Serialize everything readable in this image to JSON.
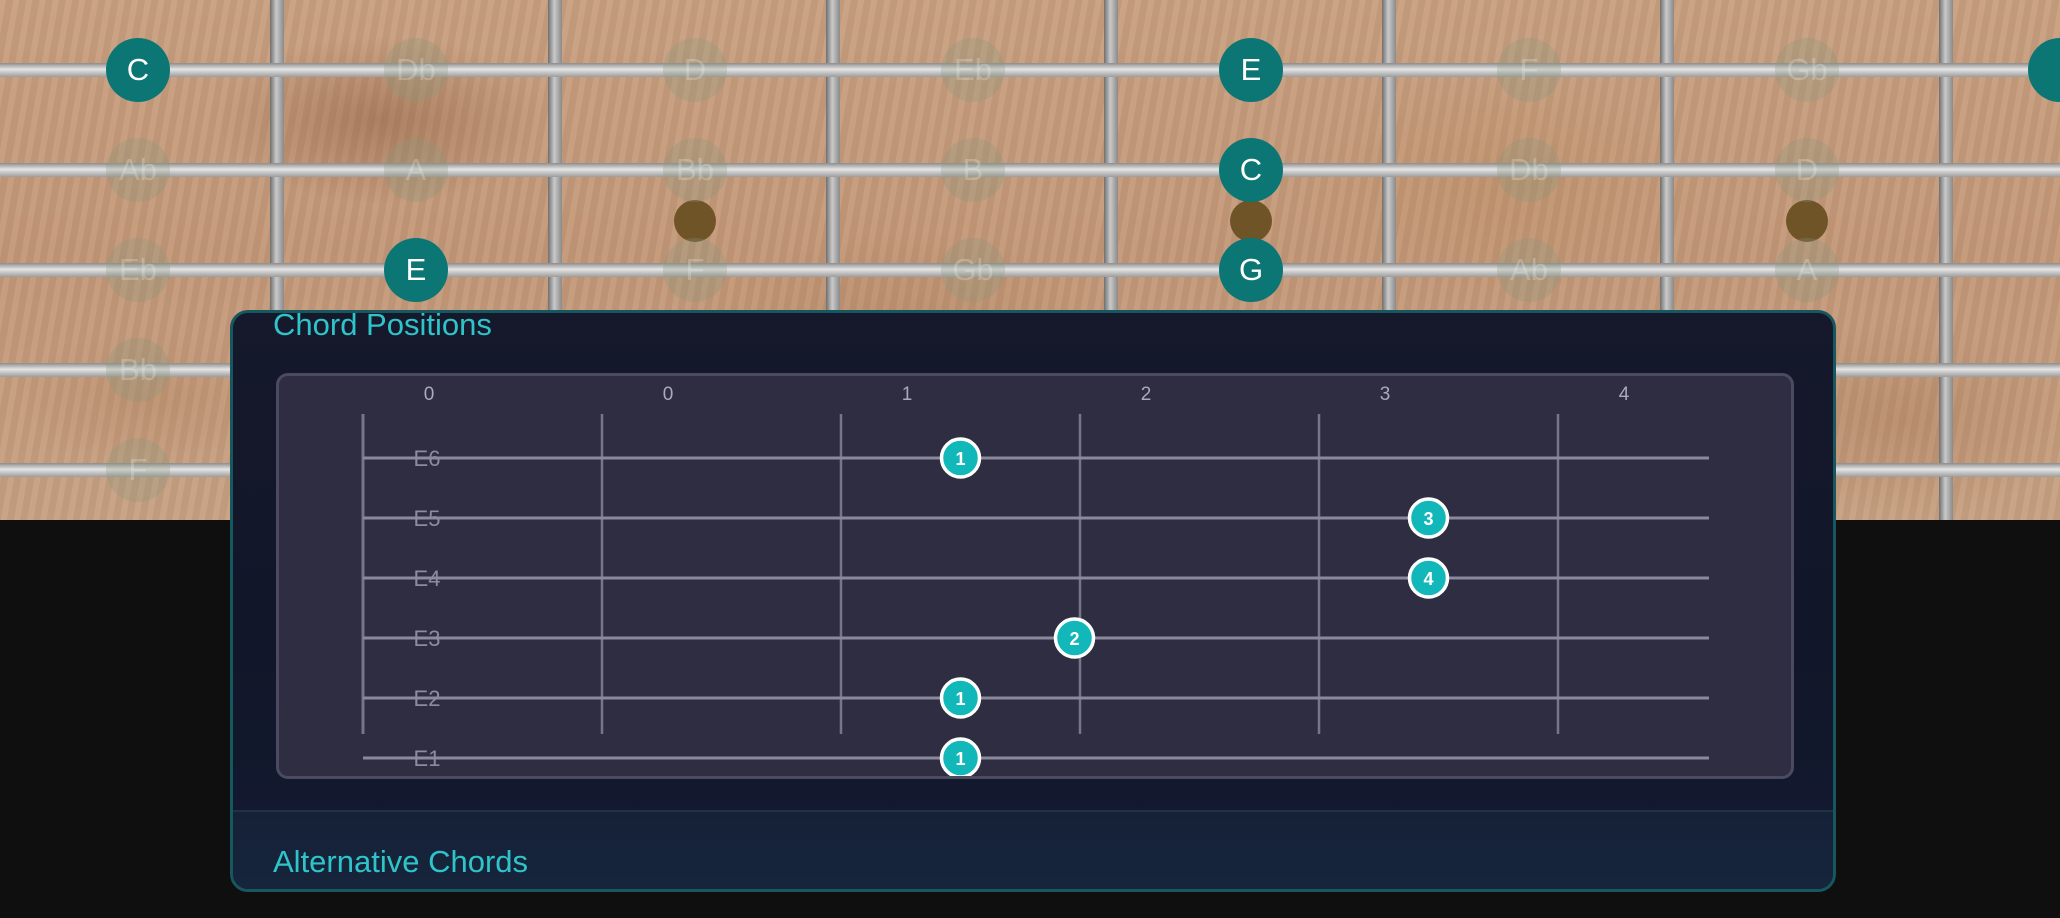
{
  "fretboard": {
    "rows": [
      {
        "notes": [
          {
            "label": "C",
            "active": true
          },
          {
            "label": "Db",
            "active": false
          },
          {
            "label": "D",
            "active": false
          },
          {
            "label": "Eb",
            "active": false
          },
          {
            "label": "E",
            "active": true
          },
          {
            "label": "F",
            "active": false
          },
          {
            "label": "Gb",
            "active": false
          },
          {
            "label": "",
            "active": true
          }
        ]
      },
      {
        "notes": [
          {
            "label": "Ab",
            "active": false
          },
          {
            "label": "A",
            "active": false
          },
          {
            "label": "Bb",
            "active": false
          },
          {
            "label": "B",
            "active": false
          },
          {
            "label": "C",
            "active": true
          },
          {
            "label": "Db",
            "active": false
          },
          {
            "label": "D",
            "active": false
          }
        ]
      },
      {
        "notes": [
          {
            "label": "Eb",
            "active": false
          },
          {
            "label": "E",
            "active": true
          },
          {
            "label": "F",
            "active": false
          },
          {
            "label": "Gb",
            "active": false
          },
          {
            "label": "G",
            "active": true
          },
          {
            "label": "Ab",
            "active": false
          },
          {
            "label": "A",
            "active": false
          }
        ]
      },
      {
        "notes": [
          {
            "label": "Bb",
            "active": false
          }
        ]
      },
      {
        "notes": [
          {
            "label": "F",
            "active": false
          },
          {
            "label": "",
            "active": true
          }
        ]
      }
    ],
    "colors": {
      "active": "#0b7674",
      "inlay": "#6f5428"
    }
  },
  "chord_positions": {
    "title": "Chord Positions",
    "fret_labels": [
      "0",
      "0",
      "1",
      "2",
      "3",
      "4"
    ],
    "string_labels": [
      "E6",
      "E5",
      "E4",
      "E3",
      "E2",
      "E1"
    ],
    "fingers": [
      {
        "string": "E6",
        "fret": 2,
        "finger": "1"
      },
      {
        "string": "E5",
        "fret": 4,
        "finger": "3"
      },
      {
        "string": "E4",
        "fret": 4,
        "finger": "4"
      },
      {
        "string": "E3",
        "fret": 3,
        "finger": "2"
      },
      {
        "string": "E2",
        "fret": 2,
        "finger": "1"
      },
      {
        "string": "E1",
        "fret": 2,
        "finger": "1"
      }
    ],
    "colors": {
      "accent": "#12b7ba",
      "background": "#2e2d41"
    }
  },
  "alternative_chords": {
    "title": "Alternative Chords"
  }
}
